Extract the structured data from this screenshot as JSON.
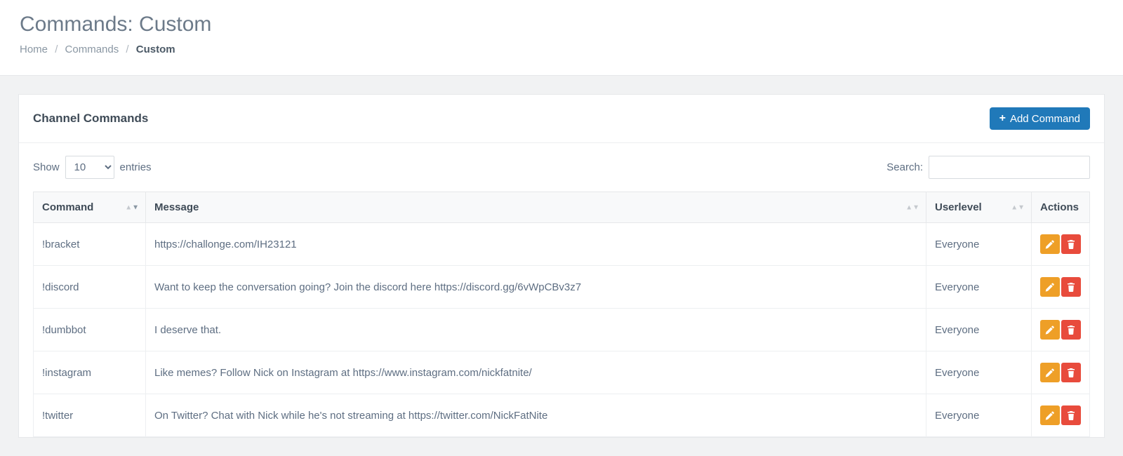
{
  "header": {
    "title": "Commands: Custom",
    "breadcrumb": {
      "home": "Home",
      "commands": "Commands",
      "current": "Custom"
    }
  },
  "panel": {
    "title": "Channel Commands",
    "add_button": "Add Command"
  },
  "datatable": {
    "length_pre": "Show",
    "length_value": "10",
    "length_post": "entries",
    "search_label": "Search:",
    "search_value": ""
  },
  "columns": {
    "command": "Command",
    "message": "Message",
    "userlevel": "Userlevel",
    "actions": "Actions"
  },
  "rows": [
    {
      "command": "!bracket",
      "message": "https://challonge.com/IH23121",
      "userlevel": "Everyone"
    },
    {
      "command": "!discord",
      "message": "Want to keep the conversation going? Join the discord here https://discord.gg/6vWpCBv3z7",
      "userlevel": "Everyone"
    },
    {
      "command": "!dumbbot",
      "message": "I deserve that.",
      "userlevel": "Everyone"
    },
    {
      "command": "!instagram",
      "message": "Like memes? Follow Nick on Instagram at https://www.instagram.com/nickfatnite/",
      "userlevel": "Everyone"
    },
    {
      "command": "!twitter",
      "message": "On Twitter? Chat with Nick while he's not streaming at https://twitter.com/NickFatNite",
      "userlevel": "Everyone"
    }
  ]
}
